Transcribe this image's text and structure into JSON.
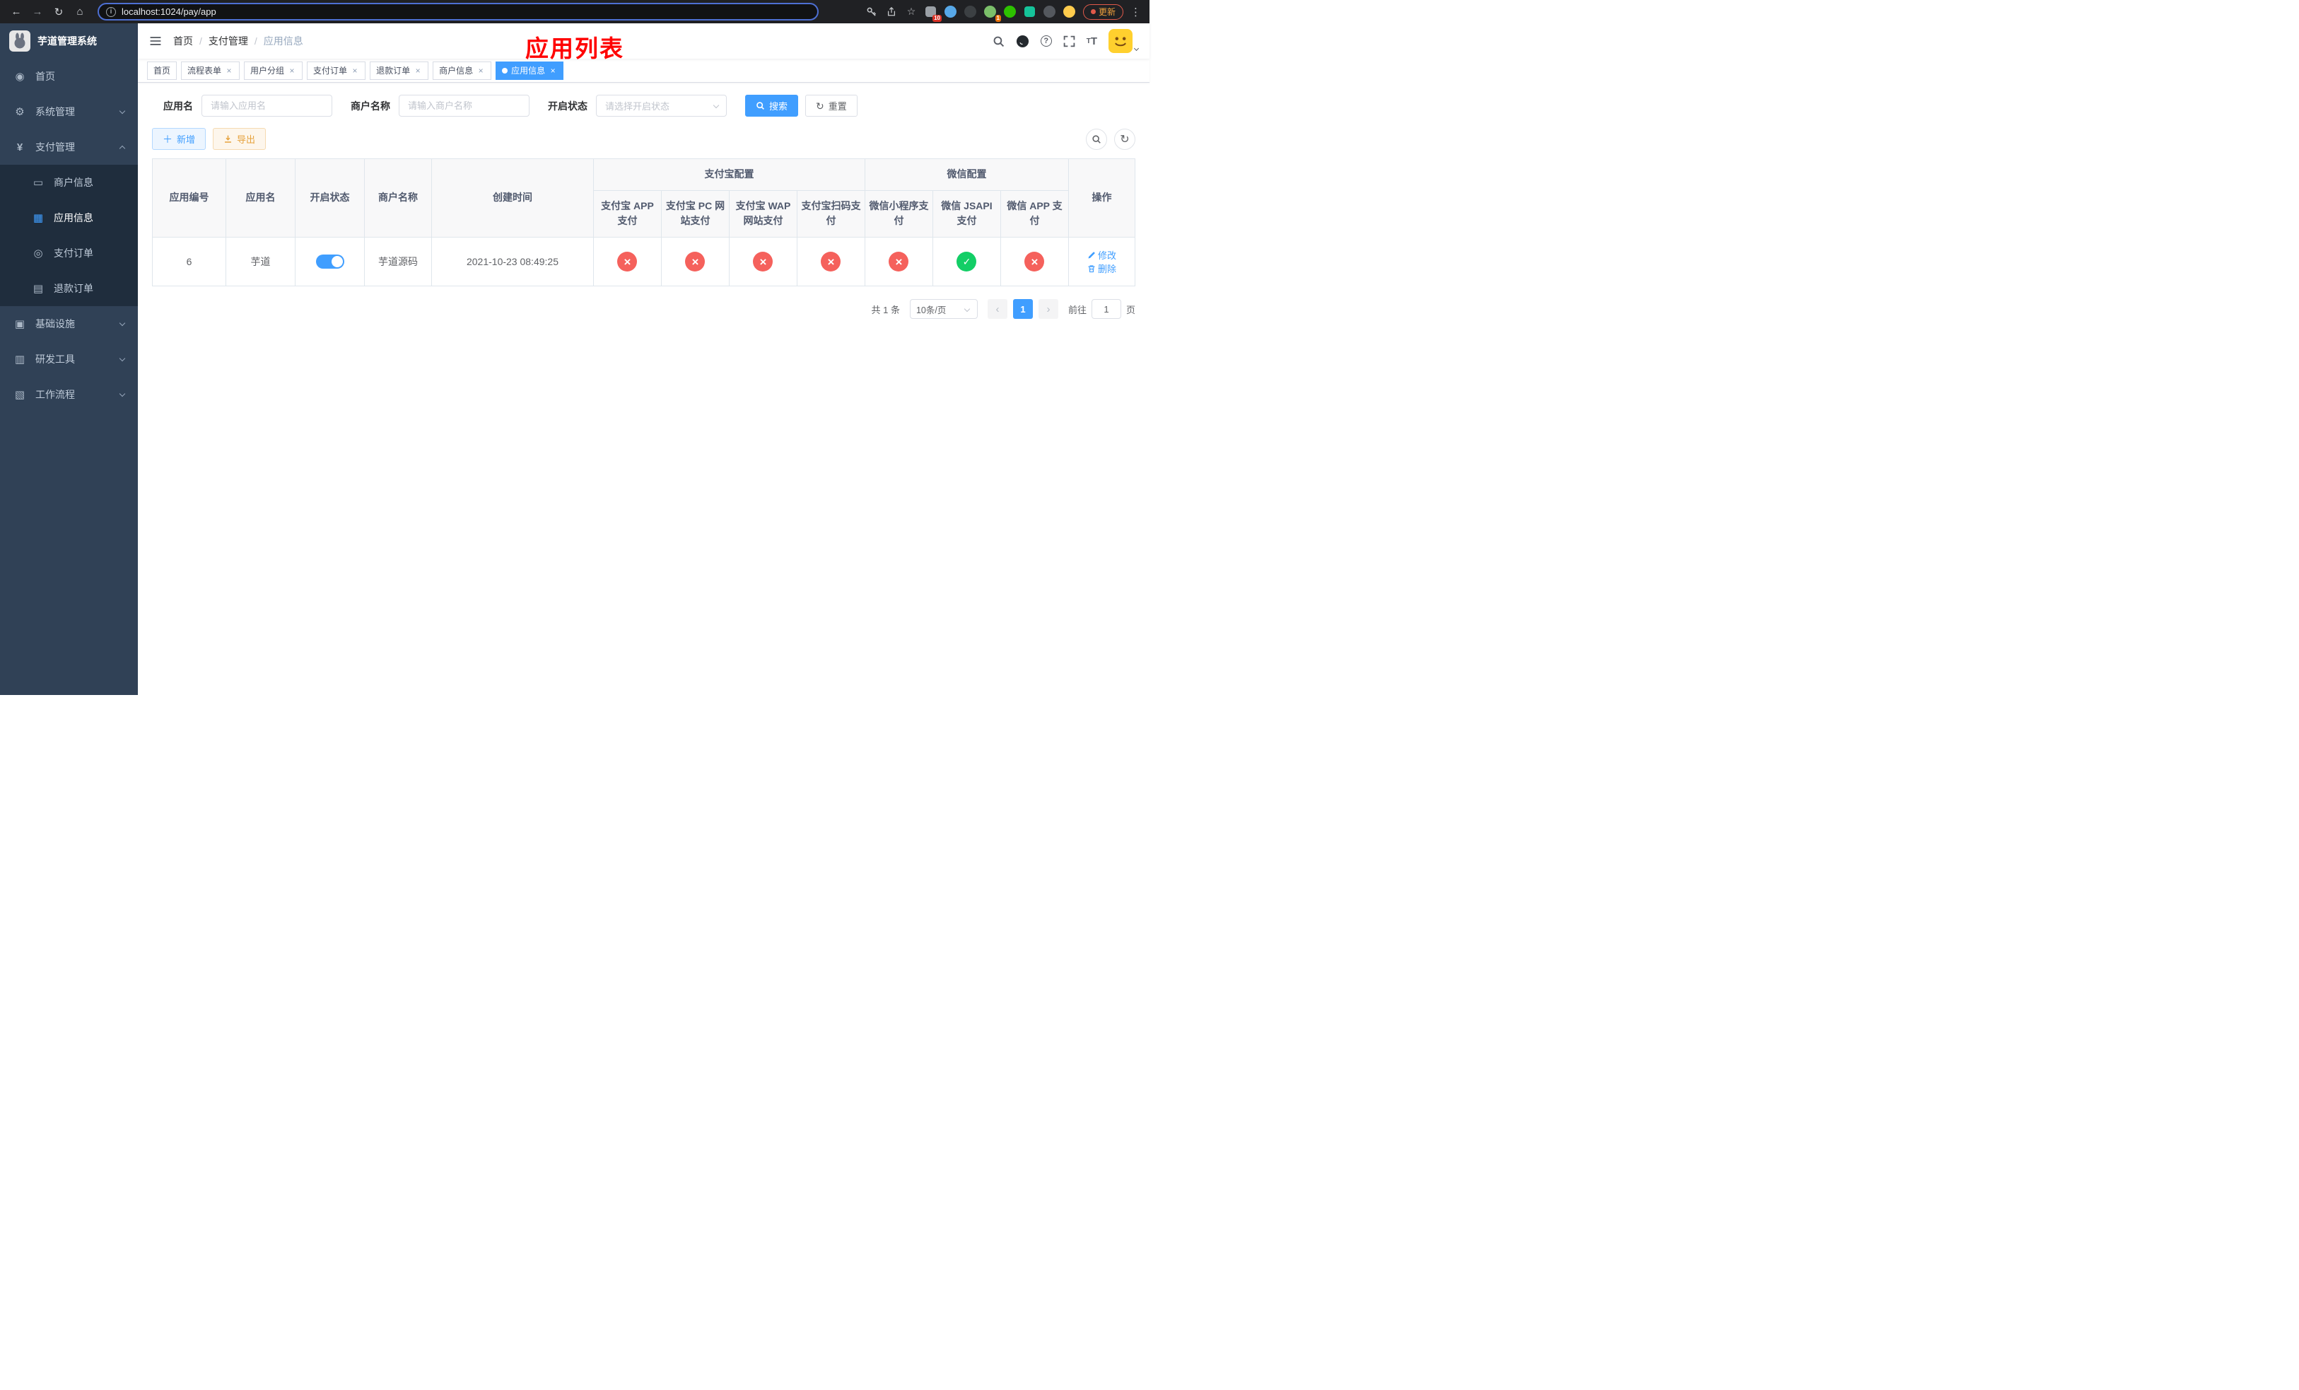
{
  "colors": {
    "accent": "#409EFF",
    "danger": "#f5615c",
    "success": "#13ce66",
    "annotation": "#ff0000"
  },
  "browser": {
    "url": "localhost:1024/pay/app",
    "update_label": "更新",
    "extensions_badge": "10",
    "profile_badge": "1"
  },
  "annotation_title": "应用列表",
  "sidebar": {
    "logo_title": "芋道管理系统",
    "home": "首页",
    "system": "系统管理",
    "payment": "支付管理",
    "merchant_info": "商户信息",
    "app_info": "应用信息",
    "pay_order": "支付订单",
    "refund_order": "退款订单",
    "infrastructure": "基础设施",
    "dev_tools": "研发工具",
    "workflow": "工作流程"
  },
  "breadcrumb": {
    "level1": "首页",
    "level2": "支付管理",
    "level3": "应用信息",
    "separator": "/"
  },
  "tabs": [
    {
      "label": "首页",
      "closable": false,
      "active": false
    },
    {
      "label": "流程表单",
      "closable": true,
      "active": false
    },
    {
      "label": "用户分组",
      "closable": true,
      "active": false
    },
    {
      "label": "支付订单",
      "closable": true,
      "active": false
    },
    {
      "label": "退款订单",
      "closable": true,
      "active": false
    },
    {
      "label": "商户信息",
      "closable": true,
      "active": false
    },
    {
      "label": "应用信息",
      "closable": true,
      "active": true
    }
  ],
  "filters": {
    "app_name_label": "应用名",
    "app_name_placeholder": "请输入应用名",
    "merchant_label": "商户名称",
    "merchant_placeholder": "请输入商户名称",
    "status_label": "开启状态",
    "status_placeholder": "请选择开启状态",
    "search_button": "搜索",
    "reset_button": "重置"
  },
  "toolbar": {
    "add_button": "新增",
    "export_button": "导出"
  },
  "table": {
    "headers": {
      "app_id": "应用编号",
      "app_name": "应用名",
      "status": "开启状态",
      "merchant": "商户名称",
      "created": "创建时间",
      "alipay_group": "支付宝配置",
      "wechat_group": "微信配置",
      "alipay_app": "支付宝 APP 支付",
      "alipay_pc": "支付宝 PC 网站支付",
      "alipay_wap": "支付宝 WAP 网站支付",
      "alipay_qr": "支付宝扫码支付",
      "wechat_mini": "微信小程序支付",
      "wechat_jsapi": "微信 JSAPI 支付",
      "wechat_app": "微信 APP 支付",
      "actions": "操作"
    },
    "rows": [
      {
        "app_id": "6",
        "app_name": "芋道",
        "enabled": true,
        "merchant": "芋道源码",
        "created": "2021-10-23 08:49:25",
        "alipay_app": "closed",
        "alipay_pc": "closed",
        "alipay_wap": "closed",
        "alipay_qr": "closed",
        "wechat_mini": "closed",
        "wechat_jsapi": "open",
        "wechat_app": "closed",
        "edit_label": "修改",
        "delete_label": "删除"
      }
    ]
  },
  "pagination": {
    "total_text": "共 1 条",
    "page_size": "10条/页",
    "current_page": "1",
    "goto_label": "前往",
    "goto_value": "1",
    "goto_suffix": "页"
  }
}
